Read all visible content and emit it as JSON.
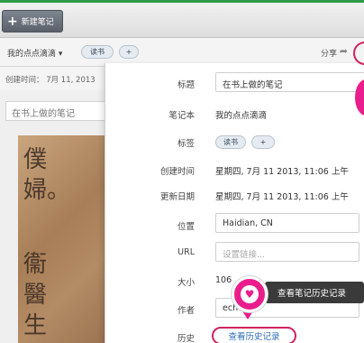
{
  "toolbar": {
    "new_note_label": "新建笔记",
    "new_note_icon": "plus-icon"
  },
  "meta_bar": {
    "notebook": "我的点点滴滴",
    "notebook_caret": "▾",
    "tag": "读书",
    "tag_add": "+",
    "share_label": "分享",
    "share_arrow": "➦"
  },
  "created_row": {
    "text": "创建时间： 7月 11, 2013"
  },
  "editor": {
    "title": "在书上做的笔记",
    "photo_chars_top": "僕婦。",
    "photo_chars_bottom": "衞醫生"
  },
  "panel": {
    "title_label": "标题",
    "title_value": "在书上做的笔记",
    "notebook_label": "笔记本",
    "notebook_value": "我的点点滴滴",
    "tags_label": "标签",
    "tag_value": "读书",
    "tag_add": "+",
    "created_label": "创建时间",
    "created_value": "星期四, 7月 11 2013, 11:06 上午",
    "updated_label": "更新日期",
    "updated_value": "星期四, 7月 11 2013, 11:06 上午",
    "location_label": "位置",
    "location_value": "Haidian, CN",
    "url_label": "URL",
    "url_placeholder": "设置链接...",
    "size_label": "大小",
    "size_value": "106",
    "author_label": "作者",
    "author_value": "ech",
    "history_label": "历史",
    "history_link": "查看历史记录"
  },
  "callout": {
    "tooltip": "查看笔记历史记录",
    "marker_icon": "heart-icon",
    "marker_glyph": "♥"
  },
  "colors": {
    "accent_green": "#2e9b48",
    "highlight_pink": "#e91e8c",
    "link_blue": "#2b6cb8",
    "ring_red": "#d0245d"
  }
}
